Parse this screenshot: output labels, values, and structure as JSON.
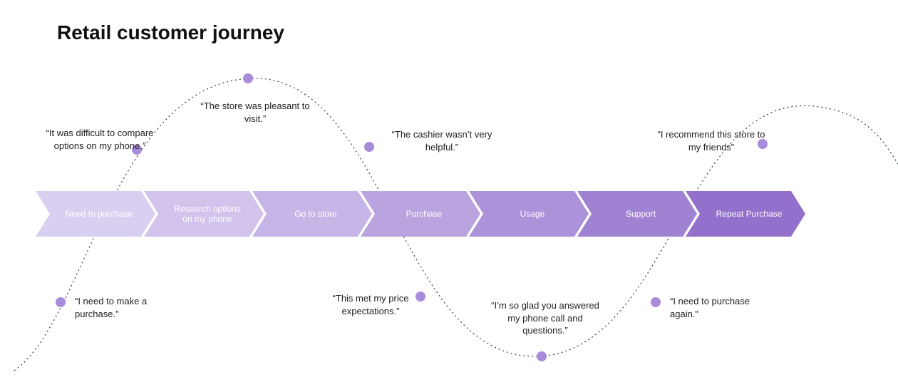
{
  "title": "Retail customer journey",
  "stages": [
    {
      "label": "Need to purchase",
      "fill": "#d9cff0"
    },
    {
      "label": "Research options on my phone",
      "fill": "#d1c3ec"
    },
    {
      "label": "Go to store",
      "fill": "#c6b6e7"
    },
    {
      "label": "Purchase",
      "fill": "#b9a4e0"
    },
    {
      "label": "Usage",
      "fill": "#ac93d9"
    },
    {
      "label": "Support",
      "fill": "#a082d3"
    },
    {
      "label": "Repeat Purchase",
      "fill": "#9370cc"
    }
  ],
  "quotes": {
    "compare": "“It was difficult to compare options on my phone.”",
    "store_pleasant": "“The store was pleasant to visit.”",
    "cashier": "“The cashier wasn’t very helpful.”",
    "recommend": "“I recommend this store to my friends”",
    "need_purchase": "“I need to make a purchase.”",
    "price": "“This met my price expectations.”",
    "glad_phone": "“I’m so glad you answered my phone call and questions.”",
    "purchase_again": "“I need to purchase again.”"
  },
  "colors": {
    "dot": "#a98bdc",
    "curve": "#2c3e2e"
  }
}
